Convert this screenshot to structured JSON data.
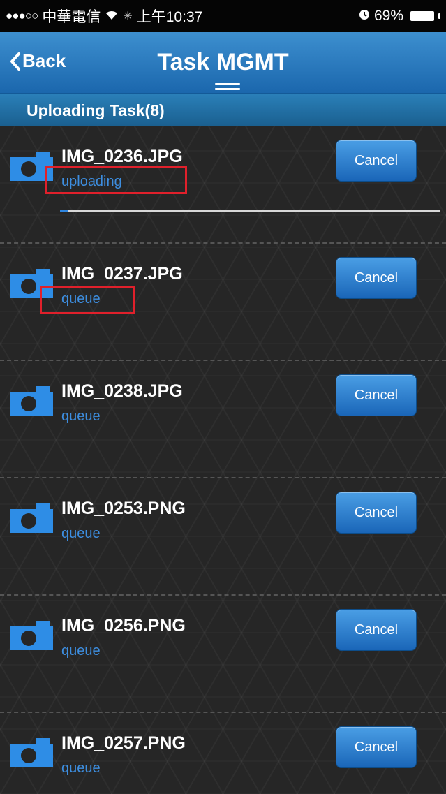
{
  "status_bar": {
    "carrier": "中華電信",
    "time": "上午10:37",
    "battery": "69%"
  },
  "nav": {
    "back_label": "Back",
    "title": "Task MGMT"
  },
  "section": {
    "title": "Uploading Task(8)"
  },
  "tasks": [
    {
      "filename": "IMG_0236.JPG",
      "status": "uploading",
      "progress": 0.02,
      "cancel_label": "Cancel"
    },
    {
      "filename": "IMG_0237.JPG",
      "status": "queue",
      "cancel_label": "Cancel"
    },
    {
      "filename": "IMG_0238.JPG",
      "status": "queue",
      "cancel_label": "Cancel"
    },
    {
      "filename": "IMG_0253.PNG",
      "status": "queue",
      "cancel_label": "Cancel"
    },
    {
      "filename": "IMG_0256.PNG",
      "status": "queue",
      "cancel_label": "Cancel"
    },
    {
      "filename": "IMG_0257.PNG",
      "status": "queue",
      "cancel_label": "Cancel"
    }
  ],
  "colors": {
    "accent": "#1b67ad",
    "status_text": "#3d8ee0",
    "highlight": "#e0202b"
  },
  "icons": {
    "task_icon": "camera-icon",
    "back_icon": "chevron-left-icon"
  }
}
